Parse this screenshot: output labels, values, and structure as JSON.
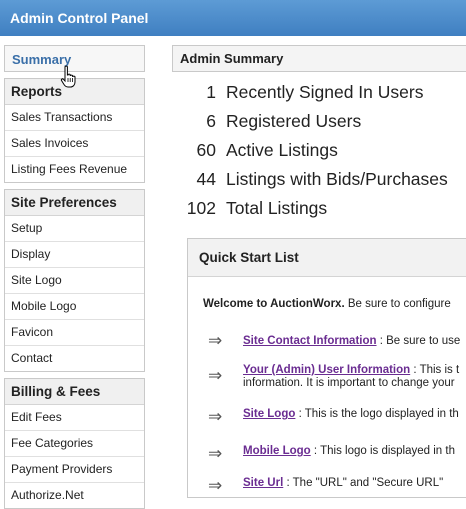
{
  "window": {
    "title": "Admin Control Panel"
  },
  "sidebar": {
    "summary_label": "Summary",
    "groups": [
      {
        "title": "Reports",
        "items": [
          "Sales Transactions",
          "Sales Invoices",
          "Listing Fees Revenue"
        ]
      },
      {
        "title": "Site Preferences",
        "items": [
          "Setup",
          "Display",
          "Site Logo",
          "Mobile Logo",
          "Favicon",
          "Contact"
        ]
      },
      {
        "title": "Billing & Fees",
        "items": [
          "Edit Fees",
          "Fee Categories",
          "Payment Providers",
          "Authorize.Net"
        ]
      }
    ]
  },
  "main": {
    "header": "Admin Summary",
    "stats": [
      {
        "value": "1",
        "label": "Recently Signed In Users"
      },
      {
        "value": "6",
        "label": "Registered Users"
      },
      {
        "value": "60",
        "label": "Active Listings"
      },
      {
        "value": "44",
        "label": "Listings with Bids/Purchases"
      },
      {
        "value": "102",
        "label": "Total Listings"
      }
    ]
  },
  "quick_start": {
    "title": "Quick Start List",
    "welcome_bold": "Welcome to AuctionWorx.",
    "welcome_rest": " Be sure to configure",
    "items": [
      {
        "link": "Site Contact Information",
        "text": " : Be sure to use",
        "text2": ""
      },
      {
        "link": "Your (Admin) User Information",
        "text": " : This is t",
        "text2": "information. It is important to change your"
      },
      {
        "link": "Site Logo",
        "text": " : This is the logo displayed in th",
        "text2": ""
      },
      {
        "link": "Mobile Logo",
        "text": " : This logo is displayed in th",
        "text2": ""
      },
      {
        "link": "Site Url",
        "text": " : The \"URL\" and \"Secure URL\"",
        "text2": ""
      }
    ]
  },
  "icons": {
    "arrow": "right-arrow-icon",
    "cursor": "hand-cursor-icon"
  }
}
